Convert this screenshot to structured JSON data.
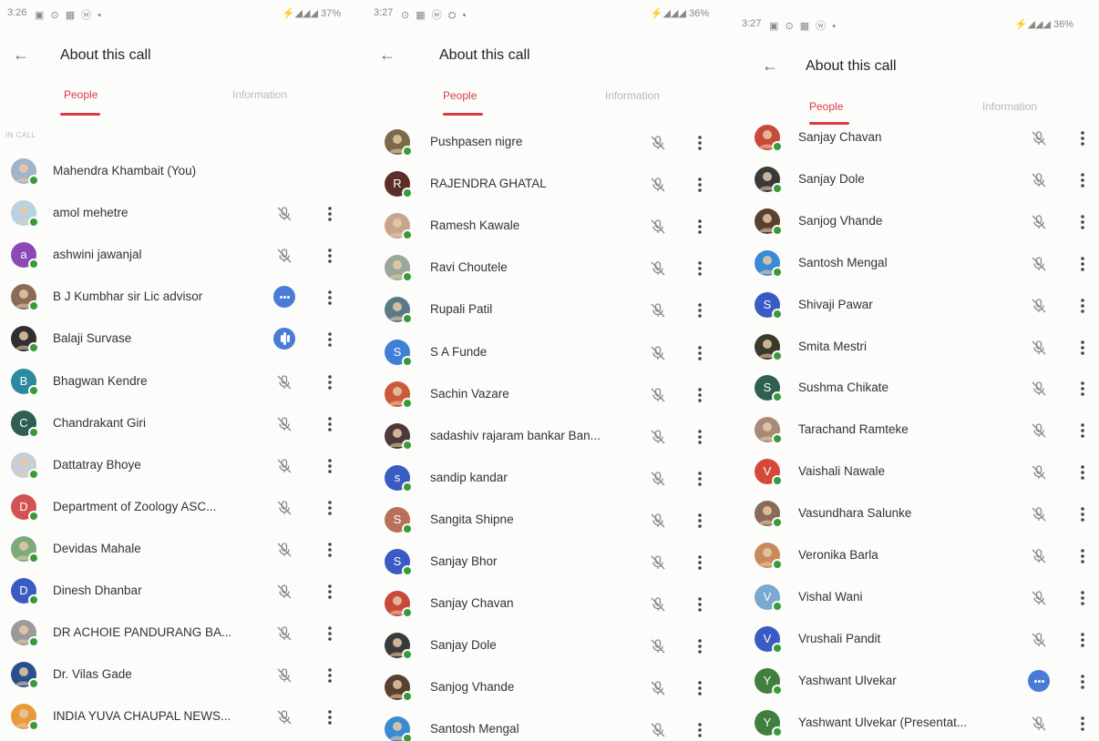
{
  "panels": [
    {
      "status": {
        "time": "3:26",
        "icons": "▣ ⊙ ▦ ⓦ •",
        "sys": "⚡◢◢◢ 37%"
      },
      "header": {
        "title": "About this call"
      },
      "tabs": {
        "people": "People",
        "information": "Information"
      },
      "section_label": "IN CALL",
      "rows": [
        {
          "name": "Mahendra Khambait (You)",
          "avatar": "photo",
          "color": "#9fb3c9",
          "mic": false,
          "more": false
        },
        {
          "name": "amol mehetre",
          "avatar": "photo",
          "color": "#b7d3e3",
          "mic": true,
          "more": true
        },
        {
          "name": "ashwini jawanjal",
          "avatar": "a",
          "color": "#8b49b5",
          "mic": true,
          "more": true
        },
        {
          "name": "B J Kumbhar sir Lic advisor",
          "avatar": "photo",
          "color": "#8a6b58",
          "speaking": "dots",
          "more": true
        },
        {
          "name": "Balaji Survase",
          "avatar": "photo",
          "color": "#2f2f2f",
          "speaking": "bars",
          "more": true
        },
        {
          "name": "Bhagwan Kendre",
          "avatar": "B",
          "color": "#2c8aa0",
          "mic": true,
          "more": true
        },
        {
          "name": "Chandrakant Giri",
          "avatar": "C",
          "color": "#2f5f52",
          "mic": true,
          "more": true
        },
        {
          "name": "Dattatray Bhoye",
          "avatar": "photo",
          "color": "#c5cfd9",
          "mic": true,
          "more": true
        },
        {
          "name": "Department of Zoology ASC...",
          "avatar": "D",
          "color": "#d45252",
          "mic": true,
          "more": true
        },
        {
          "name": "Devidas Mahale",
          "avatar": "photo",
          "color": "#7caa7c",
          "mic": true,
          "more": true
        },
        {
          "name": "Dinesh Dhanbar",
          "avatar": "D",
          "color": "#3a5bc4",
          "mic": true,
          "more": true
        },
        {
          "name": "DR ACHOIE PANDURANG BA...",
          "avatar": "photo",
          "color": "#9a9a9a",
          "mic": true,
          "more": true
        },
        {
          "name": "Dr. Vilas Gade",
          "avatar": "photo",
          "color": "#2a4f8a",
          "mic": true,
          "more": true
        },
        {
          "name": "INDIA YUVA CHAUPAL NEWS...",
          "avatar": "photo",
          "color": "#e79c3b",
          "mic": true,
          "more": true
        }
      ]
    },
    {
      "status": {
        "time": "3:27",
        "icons": "⊙ ▦ ⓦ ⛭ •",
        "sys": "⚡◢◢◢ 36%"
      },
      "header": {
        "title": "About this call"
      },
      "tabs": {
        "people": "People",
        "information": "Information"
      },
      "rows": [
        {
          "name": "Pushpasen nigre",
          "avatar": "photo",
          "color": "#7a6a4a",
          "mic": true,
          "more": true
        },
        {
          "name": "RAJENDRA GHATAL",
          "avatar": "R",
          "color": "#5a2f28",
          "mic": true,
          "more": true
        },
        {
          "name": "Ramesh Kawale",
          "avatar": "photo",
          "color": "#c6a58f",
          "mic": true,
          "more": true
        },
        {
          "name": "Ravi Choutele",
          "avatar": "photo",
          "color": "#9aa89a",
          "mic": true,
          "more": true
        },
        {
          "name": "Rupali Patil",
          "avatar": "photo",
          "color": "#5a7a8a",
          "mic": true,
          "more": true
        },
        {
          "name": "S A Funde",
          "avatar": "S",
          "color": "#3f7fd4",
          "mic": true,
          "more": true
        },
        {
          "name": "Sachin Vazare",
          "avatar": "photo",
          "color": "#c95b3a",
          "mic": true,
          "more": true
        },
        {
          "name": "sadashiv rajaram bankar Ban...",
          "avatar": "photo",
          "color": "#4a3a3a",
          "mic": true,
          "more": true
        },
        {
          "name": "sandip kandar",
          "avatar": "s",
          "color": "#3a5bc4",
          "mic": true,
          "more": true
        },
        {
          "name": "Sangita Shipne",
          "avatar": "S",
          "color": "#b8705a",
          "mic": true,
          "more": true
        },
        {
          "name": "Sanjay Bhor",
          "avatar": "S",
          "color": "#3a5bc4",
          "mic": true,
          "more": true
        },
        {
          "name": "Sanjay Chavan",
          "avatar": "photo",
          "color": "#c84a3a",
          "mic": true,
          "more": true
        },
        {
          "name": "Sanjay Dole",
          "avatar": "photo",
          "color": "#3a3a3a",
          "mic": true,
          "more": true
        },
        {
          "name": "Sanjog Vhande",
          "avatar": "photo",
          "color": "#5a4030",
          "mic": true,
          "more": true
        },
        {
          "name": "Santosh Mengal",
          "avatar": "photo",
          "color": "#3a8ad4",
          "mic": true,
          "more": true
        }
      ]
    },
    {
      "status": {
        "time": "3:27",
        "icons": "▣ ⊙ ▦ ⓦ •",
        "sys": "⚡◢◢◢ 36%"
      },
      "header": {
        "title": "About this call"
      },
      "tabs": {
        "people": "People",
        "information": "Information"
      },
      "rows": [
        {
          "name": "Sanjay Chavan",
          "avatar": "photo",
          "color": "#c84a3a",
          "mic": true,
          "more": true
        },
        {
          "name": "Sanjay Dole",
          "avatar": "photo",
          "color": "#3a3a3a",
          "mic": true,
          "more": true
        },
        {
          "name": "Sanjog Vhande",
          "avatar": "photo",
          "color": "#5a4030",
          "mic": true,
          "more": true
        },
        {
          "name": "Santosh Mengal",
          "avatar": "photo",
          "color": "#3a8ad4",
          "mic": true,
          "more": true
        },
        {
          "name": "Shivaji Pawar",
          "avatar": "S",
          "color": "#3a5bc4",
          "mic": true,
          "more": true
        },
        {
          "name": "Smita Mestri",
          "avatar": "photo",
          "color": "#3a3a2a",
          "mic": true,
          "more": true
        },
        {
          "name": "Sushma Chikate",
          "avatar": "S",
          "color": "#2f5f52",
          "mic": true,
          "more": true
        },
        {
          "name": "Tarachand Ramteke",
          "avatar": "photo",
          "color": "#a88a7a",
          "mic": true,
          "more": true
        },
        {
          "name": "Vaishali Nawale",
          "avatar": "V",
          "color": "#d44a3a",
          "mic": true,
          "more": true
        },
        {
          "name": "Vasundhara Salunke",
          "avatar": "photo",
          "color": "#8a6a5a",
          "mic": true,
          "more": true
        },
        {
          "name": "Veronika Barla",
          "avatar": "photo",
          "color": "#c88a5a",
          "mic": true,
          "more": true
        },
        {
          "name": "Vishal Wani",
          "avatar": "V",
          "color": "#7aa8cf",
          "mic": true,
          "more": true
        },
        {
          "name": "Vrushali Pandit",
          "avatar": "V",
          "color": "#3a5bc4",
          "mic": true,
          "more": true
        },
        {
          "name": "Yashwant Ulvekar",
          "avatar": "Y",
          "color": "#3f7f3f",
          "speaking": "dots",
          "more": true
        },
        {
          "name": "Yashwant Ulvekar (Presentat...",
          "avatar": "Y",
          "color": "#3f7f3f",
          "mic": true,
          "more": true
        }
      ]
    }
  ],
  "colors": {
    "accent": "#d93c45",
    "online": "#3a9a3a",
    "active_speaker": "#4a7bd7"
  }
}
